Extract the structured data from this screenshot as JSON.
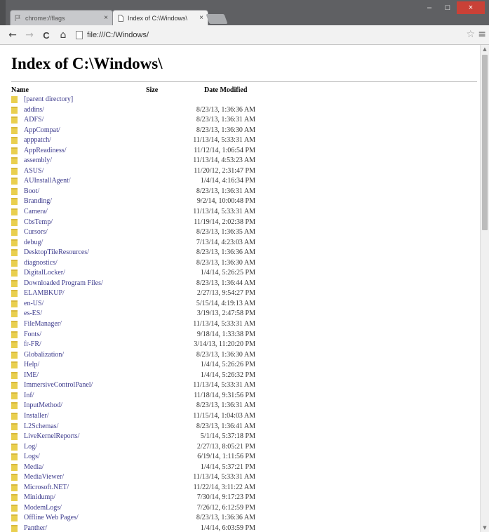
{
  "browser": {
    "tabs": [
      {
        "label": "chrome://flags",
        "close": "×",
        "active": false
      },
      {
        "label": "Index of C:\\Windows\\",
        "close": "×",
        "active": true
      }
    ],
    "window_controls": {
      "minimize": "–",
      "maximize": "□",
      "close": "×"
    },
    "nav": {
      "back": "←",
      "forward": "→",
      "reload": "C",
      "home": "⌂"
    },
    "address": "file:///C:/Windows/",
    "star": "☆",
    "menu": "≡"
  },
  "page": {
    "title": "Index of C:\\Windows\\",
    "columns": {
      "name": "Name",
      "size": "Size",
      "date": "Date Modified"
    },
    "parent": "[parent directory]",
    "entries": [
      {
        "name": "addins/",
        "date": "8/23/13, 1:36:36 AM"
      },
      {
        "name": "ADFS/",
        "date": "8/23/13, 1:36:31 AM"
      },
      {
        "name": "AppCompat/",
        "date": "8/23/13, 1:36:30 AM"
      },
      {
        "name": "apppatch/",
        "date": "11/13/14, 5:33:31 AM"
      },
      {
        "name": "AppReadiness/",
        "date": "11/12/14, 1:06:54 PM"
      },
      {
        "name": "assembly/",
        "date": "11/13/14, 4:53:23 AM"
      },
      {
        "name": "ASUS/",
        "date": "11/20/12, 2:31:47 PM"
      },
      {
        "name": "AUInstallAgent/",
        "date": "1/4/14, 4:16:34 PM"
      },
      {
        "name": "Boot/",
        "date": "8/23/13, 1:36:31 AM"
      },
      {
        "name": "Branding/",
        "date": "9/2/14, 10:00:48 PM"
      },
      {
        "name": "Camera/",
        "date": "11/13/14, 5:33:31 AM"
      },
      {
        "name": "CbsTemp/",
        "date": "11/19/14, 2:02:38 PM"
      },
      {
        "name": "Cursors/",
        "date": "8/23/13, 1:36:35 AM"
      },
      {
        "name": "debug/",
        "date": "7/13/14, 4:23:03 AM"
      },
      {
        "name": "DesktopTileResources/",
        "date": "8/23/13, 1:36:36 AM"
      },
      {
        "name": "diagnostics/",
        "date": "8/23/13, 1:36:30 AM"
      },
      {
        "name": "DigitalLocker/",
        "date": "1/4/14, 5:26:25 PM"
      },
      {
        "name": "Downloaded Program Files/",
        "date": "8/23/13, 1:36:44 AM"
      },
      {
        "name": "ELAMBKUP/",
        "date": "2/27/13, 9:54:27 PM"
      },
      {
        "name": "en-US/",
        "date": "5/15/14, 4:19:13 AM"
      },
      {
        "name": "es-ES/",
        "date": "3/19/13, 2:47:58 PM"
      },
      {
        "name": "FileManager/",
        "date": "11/13/14, 5:33:31 AM"
      },
      {
        "name": "Fonts/",
        "date": "9/18/14, 1:33:38 PM"
      },
      {
        "name": "fr-FR/",
        "date": "3/14/13, 11:20:20 PM"
      },
      {
        "name": "Globalization/",
        "date": "8/23/13, 1:36:30 AM"
      },
      {
        "name": "Help/",
        "date": "1/4/14, 5:26:26 PM"
      },
      {
        "name": "IME/",
        "date": "1/4/14, 5:26:32 PM"
      },
      {
        "name": "ImmersiveControlPanel/",
        "date": "11/13/14, 5:33:31 AM"
      },
      {
        "name": "Inf/",
        "date": "11/18/14, 9:31:56 PM"
      },
      {
        "name": "InputMethod/",
        "date": "8/23/13, 1:36:31 AM"
      },
      {
        "name": "Installer/",
        "date": "11/15/14, 1:04:03 AM"
      },
      {
        "name": "L2Schemas/",
        "date": "8/23/13, 1:36:41 AM"
      },
      {
        "name": "LiveKernelReports/",
        "date": "5/1/14, 5:37:18 PM"
      },
      {
        "name": "Log/",
        "date": "2/27/13, 8:05:21 PM"
      },
      {
        "name": "Logs/",
        "date": "6/19/14, 1:11:56 PM"
      },
      {
        "name": "Media/",
        "date": "1/4/14, 5:37:21 PM"
      },
      {
        "name": "MediaViewer/",
        "date": "11/13/14, 5:33:31 AM"
      },
      {
        "name": "Microsoft.NET/",
        "date": "11/22/14, 3:11:22 AM"
      },
      {
        "name": "Minidump/",
        "date": "7/30/14, 9:17:23 PM"
      },
      {
        "name": "ModemLogs/",
        "date": "7/26/12, 6:12:59 PM"
      },
      {
        "name": "Offline Web Pages/",
        "date": "8/23/13, 1:36:36 AM"
      },
      {
        "name": "Panther/",
        "date": "1/4/14, 6:03:59 PM"
      }
    ]
  },
  "colors": {
    "titlebar": "#5f6063",
    "link": "#3c3a8c",
    "folder": "#e9cf4f",
    "close_button": "#c94137"
  }
}
